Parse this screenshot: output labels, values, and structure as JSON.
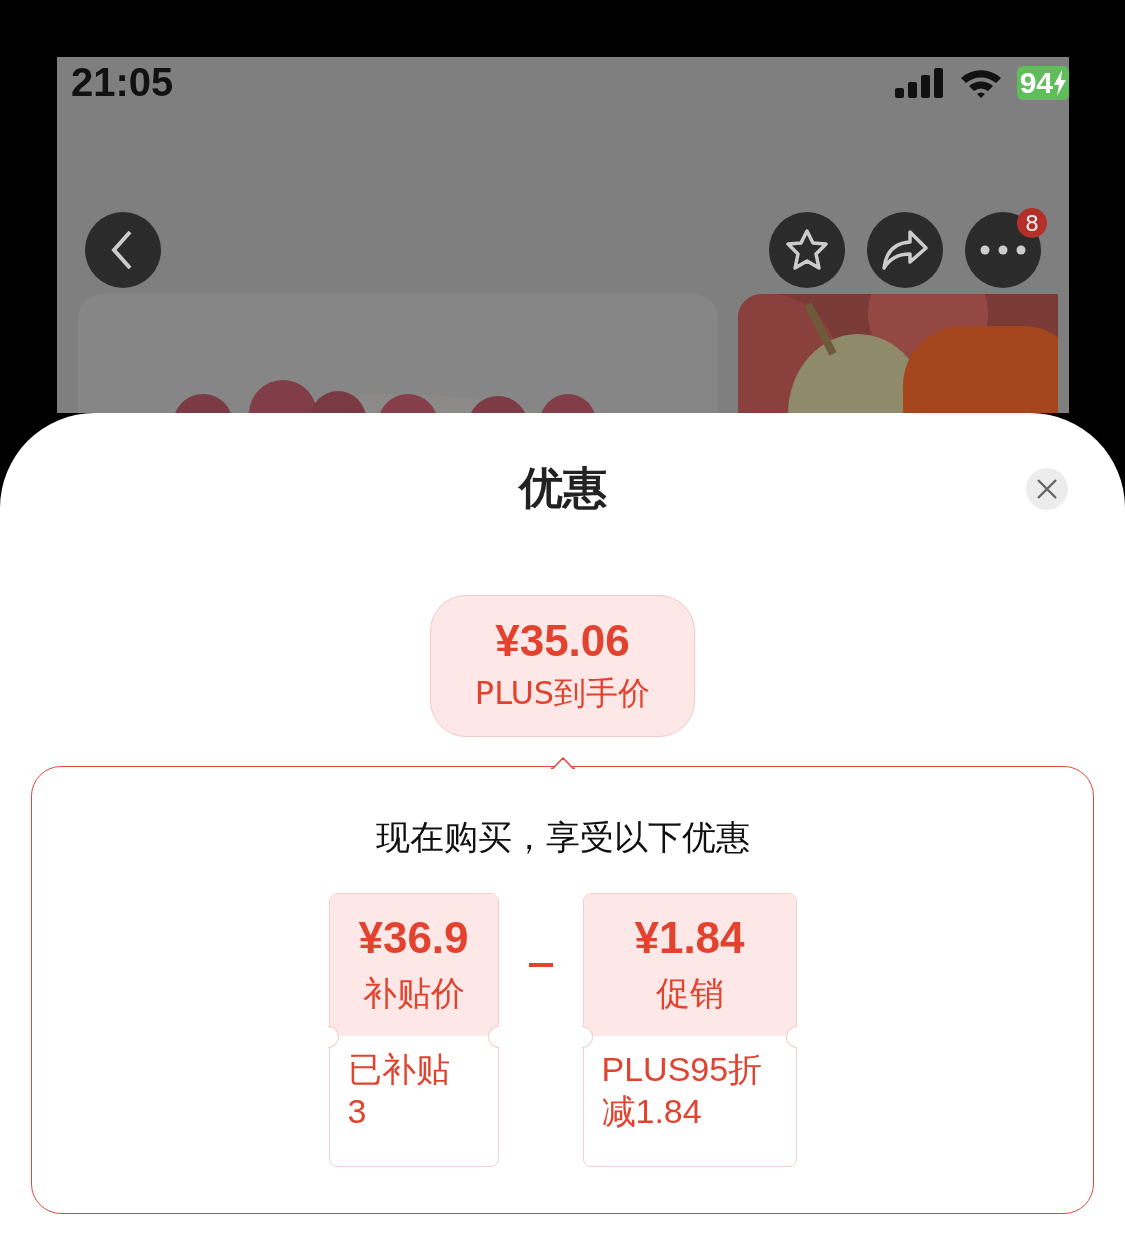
{
  "status_bar": {
    "time": "21:05",
    "battery": "94"
  },
  "nav": {
    "badge": "8"
  },
  "sheet": {
    "title": "优惠",
    "final_price": {
      "amount": "¥35.06",
      "label": "PLUS到手价"
    },
    "heading": "现在购买，享受以下优惠",
    "items": [
      {
        "amount": "¥36.9",
        "label": "补贴价",
        "detail": "已补贴3"
      },
      {
        "amount": "¥1.84",
        "label": "促销",
        "detail": "PLUS95折减1.84"
      }
    ]
  }
}
